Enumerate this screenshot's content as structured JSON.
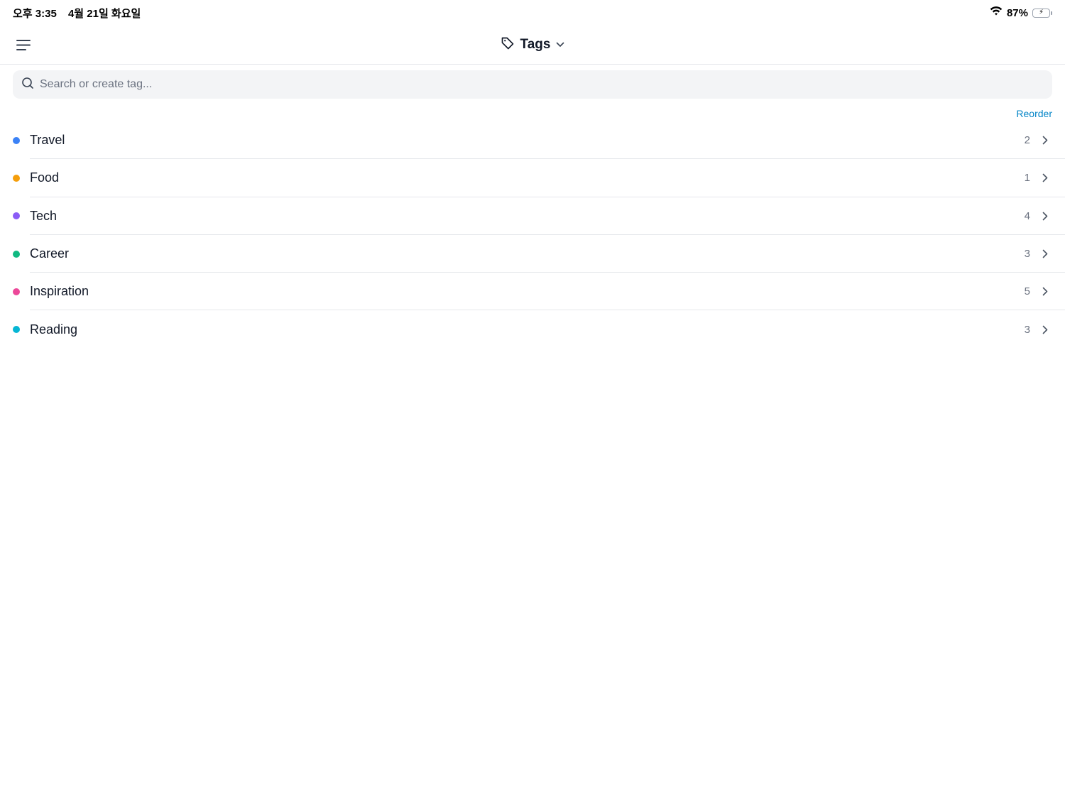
{
  "status_bar": {
    "time": "오후 3:35",
    "date": "4월 21일 화요일",
    "battery_percent": "87%",
    "battery_level": 0.87,
    "charging": true,
    "wifi_icon": "wifi-icon"
  },
  "header": {
    "menu_icon": "hamburger-menu-icon",
    "title_icon": "tag-icon",
    "title": "Tags",
    "dropdown_icon": "chevron-down-icon"
  },
  "search": {
    "icon": "search-icon",
    "placeholder": "Search or create tag...",
    "value": ""
  },
  "reorder_label": "Reorder",
  "tags": [
    {
      "label": "Travel",
      "count": "2",
      "color": "#3b82f6"
    },
    {
      "label": "Food",
      "count": "1",
      "color": "#f59e0b"
    },
    {
      "label": "Tech",
      "count": "4",
      "color": "#8b5cf6"
    },
    {
      "label": "Career",
      "count": "3",
      "color": "#10b981"
    },
    {
      "label": "Inspiration",
      "count": "5",
      "color": "#ec4899"
    },
    {
      "label": "Reading",
      "count": "3",
      "color": "#06b6d4"
    }
  ],
  "colors": {
    "accent": "#0284c7",
    "search_bg": "#f3f4f6",
    "divider": "#e5e7eb"
  }
}
